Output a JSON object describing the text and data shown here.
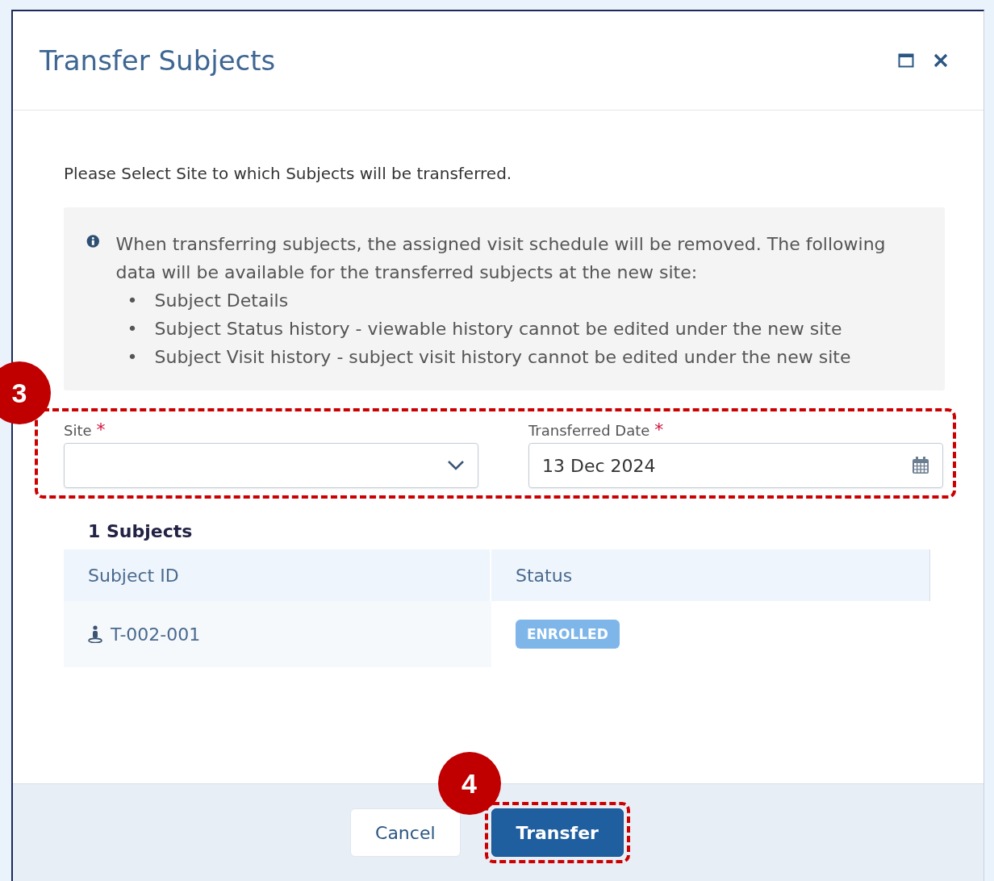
{
  "dialog": {
    "title": "Transfer Subjects"
  },
  "instruction": "Please Select Site to which Subjects will be transferred.",
  "info": {
    "text": "When transferring subjects, the assigned visit schedule will be removed. The following data will be available for the transferred subjects at the new site:",
    "bullets": [
      {
        "marker": "•",
        "text": "Subject Details"
      },
      {
        "marker": "•",
        "text": "Subject Status history - viewable history cannot be edited under the new site"
      },
      {
        "marker": "•",
        "text": "Subject Visit history - subject visit history cannot be edited under the new site"
      }
    ]
  },
  "fields": [
    {
      "kind": "select",
      "label": "Site",
      "required_mark": "*"
    },
    {
      "kind": "date",
      "label": "Transferred Date",
      "required_mark": "*",
      "value": "13 Dec 2024"
    }
  ],
  "subjects": {
    "count_label": "1 Subjects",
    "columns": [
      "Subject ID",
      "Status"
    ],
    "rows": [
      {
        "subject_id": "T-002-001",
        "status": "ENROLLED"
      }
    ]
  },
  "buttons": [
    {
      "label": "Cancel",
      "kind": "secondary"
    },
    {
      "label": "Transfer",
      "kind": "primary"
    }
  ],
  "annotations": [
    {
      "number": "3"
    },
    {
      "number": "4"
    }
  ]
}
